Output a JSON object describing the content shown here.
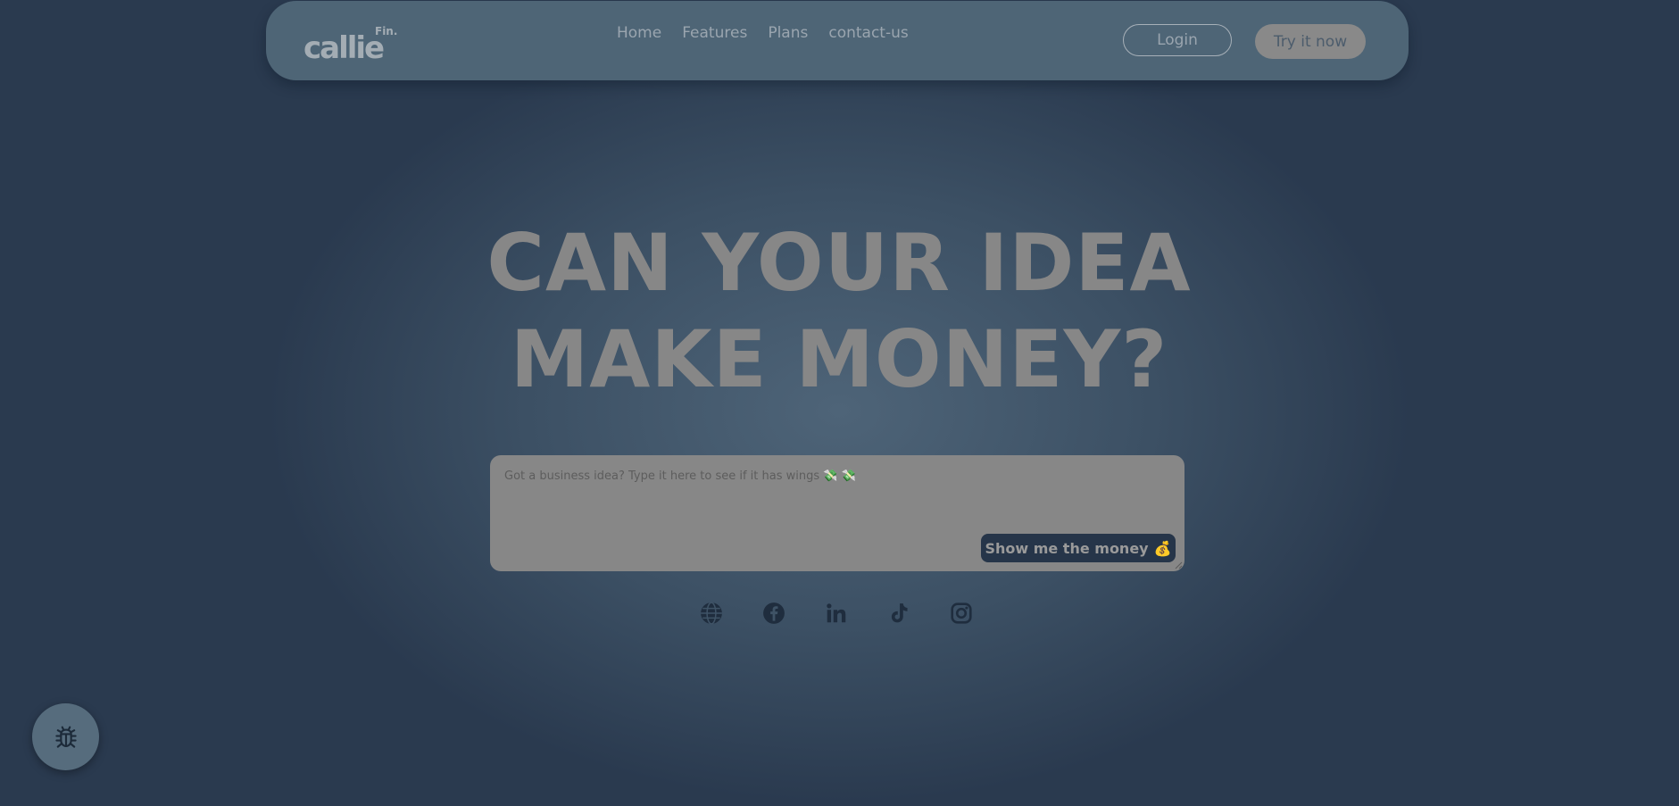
{
  "brand": {
    "logo_text": "callie",
    "logo_superscript": "Fin."
  },
  "nav": {
    "links": [
      "Home",
      "Features",
      "Plans",
      "contact-us"
    ],
    "login_label": "Login",
    "try_label": "Try it now"
  },
  "hero": {
    "title_line1": "CAN YOUR IDEA",
    "title_line2": "MAKE MONEY?"
  },
  "idea_form": {
    "placeholder": "Got a business idea? Type it here to see if it has wings 💸 💸",
    "submit_label": "Show me the money",
    "submit_emoji": "💰"
  },
  "socials": [
    {
      "icon": "globe-icon"
    },
    {
      "icon": "facebook-icon"
    },
    {
      "icon": "linkedin-icon"
    },
    {
      "icon": "tiktok-icon"
    },
    {
      "icon": "instagram-icon"
    }
  ],
  "colors": {
    "accent_dark": "#263549",
    "nav_bg": "#4e6576",
    "muted_gray": "#878787"
  }
}
